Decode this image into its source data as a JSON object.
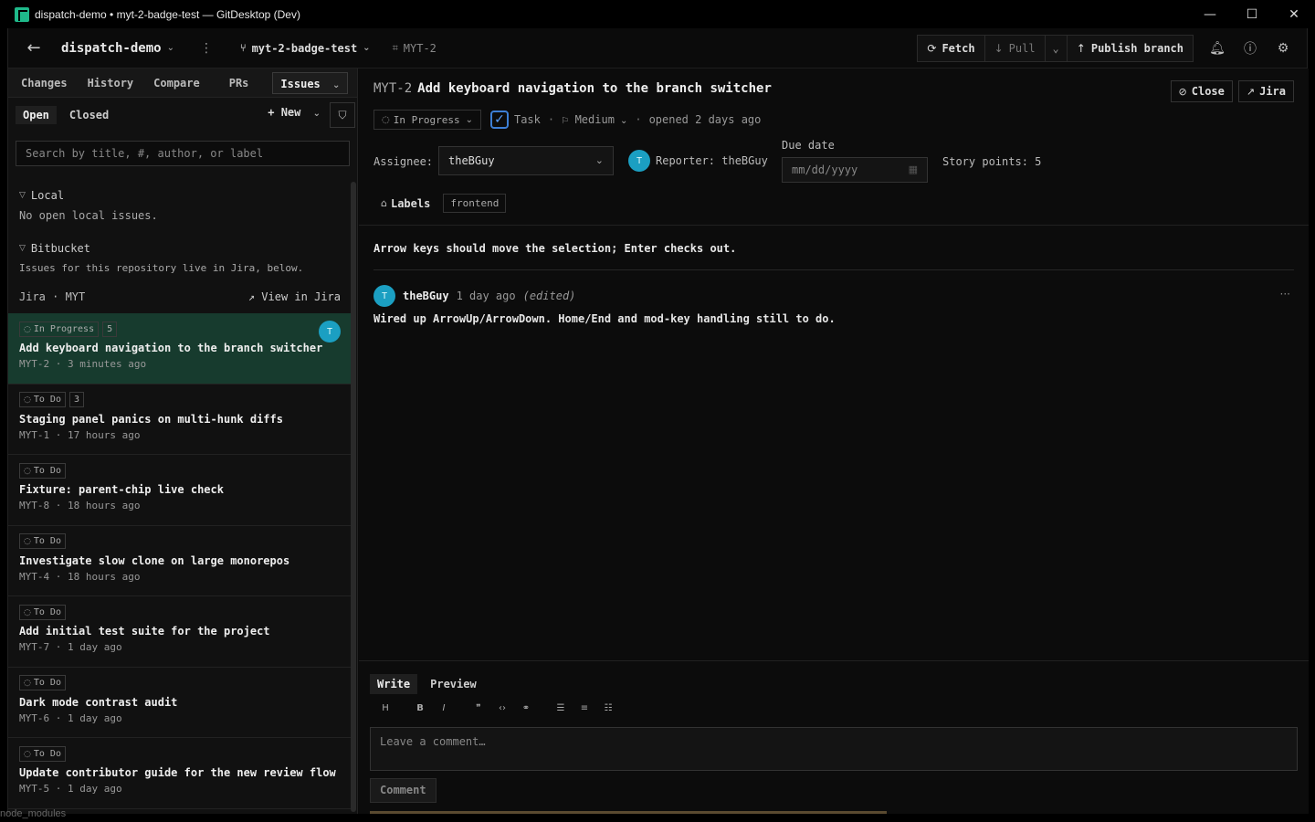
{
  "window": {
    "title": "dispatch-demo • myt-2-badge-test — GitDesktop (Dev)",
    "minimize": "—",
    "maximize": "☐",
    "close": "✕"
  },
  "toolbar": {
    "back_icon": "←",
    "repo": "dispatch-demo",
    "branch": "myt-2-badge-test",
    "issue_ref": "MYT-2",
    "fetch": "Fetch",
    "pull": "Pull",
    "publish": "Publish branch"
  },
  "sidebar": {
    "tabs": [
      "Changes",
      "History",
      "Compare",
      "PRs",
      "Issues"
    ],
    "filter_open": "Open",
    "filter_closed": "Closed",
    "new_label": "New",
    "search_placeholder": "Search by title, #, author, or label",
    "local_section": "Local",
    "local_empty": "No open local issues.",
    "bitbucket_section": "Bitbucket",
    "bitbucket_note": "Issues for this repository live in Jira, below.",
    "jira_label": "Jira · MYT",
    "view_in_jira": "View in Jira",
    "issues": [
      {
        "status": "In Progress",
        "count": "5",
        "title": "Add keyboard navigation to the branch switcher",
        "meta": "MYT-2 · 3 minutes ago",
        "avatar": "T"
      },
      {
        "status": "To Do",
        "count": "3",
        "title": "Staging panel panics on multi-hunk diffs",
        "meta": "MYT-1 · 17 hours ago"
      },
      {
        "status": "To Do",
        "title": "Fixture: parent-chip live check",
        "meta": "MYT-8 · 18 hours ago"
      },
      {
        "status": "To Do",
        "title": "Investigate slow clone on large monorepos",
        "meta": "MYT-4 · 18 hours ago"
      },
      {
        "status": "To Do",
        "title": "Add initial test suite for the project",
        "meta": "MYT-7 · 1 day ago"
      },
      {
        "status": "To Do",
        "title": "Dark mode contrast audit",
        "meta": "MYT-6 · 1 day ago"
      },
      {
        "status": "To Do",
        "title": "Update contributor guide for the new review flow",
        "meta": "MYT-5 · 1 day ago"
      }
    ]
  },
  "issue": {
    "key": "MYT-2",
    "title": "Add keyboard navigation to the branch switcher",
    "close_label": "Close",
    "jira_label": "Jira",
    "status": "In Progress",
    "type": "Task",
    "priority": "Medium",
    "opened": "opened 2 days ago",
    "assignee_label": "Assignee:",
    "assignee": "theBGuy",
    "reporter": "Reporter: theBGuy",
    "reporter_avatar": "T",
    "due_label": "Due date",
    "due_placeholder": "mm/dd/yyyy",
    "story_points": "Story points: 5",
    "labels_label": "Labels",
    "labels": [
      "frontend"
    ],
    "description": "Arrow keys should move the selection; Enter checks out."
  },
  "comment": {
    "avatar": "T",
    "author": "theBGuy",
    "when": "1 day ago",
    "edited": "(edited)",
    "body": "Wired up ArrowUp/ArrowDown. Home/End and mod-key handling still to do."
  },
  "composer": {
    "write": "Write",
    "preview": "Preview",
    "placeholder": "Leave a comment…",
    "submit": "Comment"
  },
  "edge": {
    "bottom_left_text": "node_modules"
  },
  "colors": {
    "accent_selected": "#173b2e",
    "avatar": "#1b9fc2",
    "checkbox": "#3d7fd6"
  }
}
